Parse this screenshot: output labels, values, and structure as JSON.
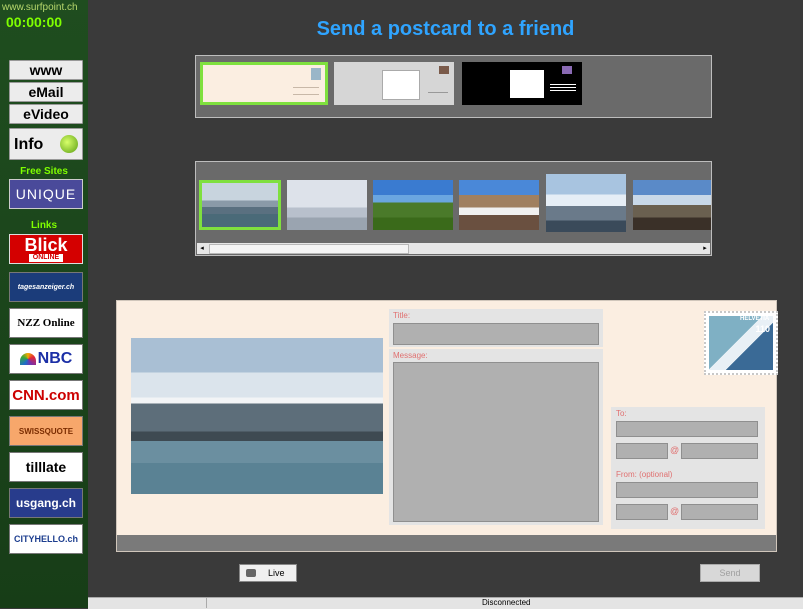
{
  "sidebar": {
    "site_url": "www.surfpoint.ch",
    "timer": "00:00:00",
    "buttons": {
      "www": "www",
      "email": "eMail",
      "evideo": "eVideo",
      "info": "Info"
    },
    "free_sites_label": "Free Sites",
    "links_label": "Links",
    "logos": {
      "unique": "UNIQUE",
      "blick": "Blick",
      "blick_sub": "ONLINE",
      "tagesanzeiger": "tagesanzeiger.ch",
      "nzz": "NZZ Online",
      "nbc": "NBC",
      "cnn": "CNN.com",
      "swissquote": "SWISSQUOTE",
      "tilllate": "tilllate",
      "usgang": "usgang.ch",
      "cityhello": "CITYHELLO.ch"
    }
  },
  "main": {
    "title": "Send a postcard to a friend"
  },
  "card": {
    "title_label": "Title:",
    "message_label": "Message:",
    "to_label": "To:",
    "from_label": "From: (optional)",
    "at_symbol": "@",
    "stamp_text": "HELVETIA",
    "stamp_value": "110"
  },
  "bottom": {
    "live_label": "Live",
    "send_label": "Send"
  },
  "status": {
    "connection": "Disconnected"
  }
}
